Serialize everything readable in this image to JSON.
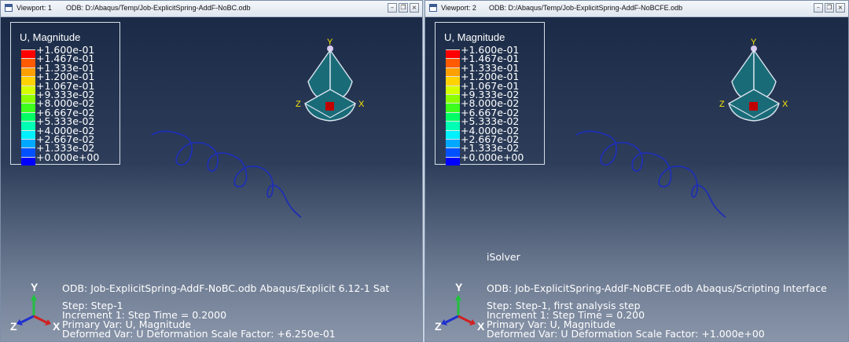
{
  "viewports": [
    {
      "name": "Viewport: 1",
      "odb_path": "ODB: D:/Abaqus/Temp/Job-ExplicitSpring-AddF-NoBC.odb",
      "window_buttons": [
        "minimize",
        "restore",
        "close"
      ],
      "legend_title": "U, Magnitude",
      "info_lines": [
        "ODB: Job-ExplicitSpring-AddF-NoBC.odb    Abaqus/Explicit 6.12-1    Sat",
        "",
        "Step: Step-1",
        "Increment        1: Step Time =    0.2000",
        "Primary Var: U, Magnitude",
        "Deformed Var: U   Deformation Scale Factor: +6.250e-01"
      ]
    },
    {
      "name": "Viewport: 2",
      "odb_path": "ODB: D:/Abaqus/Temp/Job-ExplicitSpring-AddF-NoBCFE.odb",
      "window_buttons": [
        "minimize",
        "restore",
        "close"
      ],
      "legend_title": "U, Magnitude",
      "info_lines": [
        "iSolver",
        "ODB: Job-ExplicitSpring-AddF-NoBCFE.odb    Abaqus/Scripting Interface",
        "Step: Step-1, first analysis step",
        "Increment        1: Step Time =    0.200",
        "Primary Var: U, Magnitude",
        "Deformed Var: U   Deformation Scale Factor: +1.000e+00"
      ]
    }
  ],
  "legend_labels": [
    "+1.600e-01",
    "+1.467e-01",
    "+1.333e-01",
    "+1.200e-01",
    "+1.067e-01",
    "+9.333e-02",
    "+8.000e-02",
    "+6.667e-02",
    "+5.333e-02",
    "+4.000e-02",
    "+2.667e-02",
    "+1.333e-02",
    "+0.000e+00"
  ],
  "legend_colors": [
    "#ff0000",
    "#ff5a00",
    "#ffa000",
    "#ffd200",
    "#d6ff00",
    "#8cff00",
    "#3cff1e",
    "#00ff64",
    "#00ffb4",
    "#00f0ff",
    "#00a8ff",
    "#0050ff",
    "#0000ff"
  ],
  "triad_labels": {
    "y": "Y",
    "z": "Z",
    "x": "X"
  },
  "axis_labels": {
    "y": "Y",
    "z": "Z",
    "x": "X"
  },
  "colors": {
    "spring": "#1e2fb4",
    "triad_label": "#ffe800",
    "triad_fill": "#1a6b78"
  }
}
